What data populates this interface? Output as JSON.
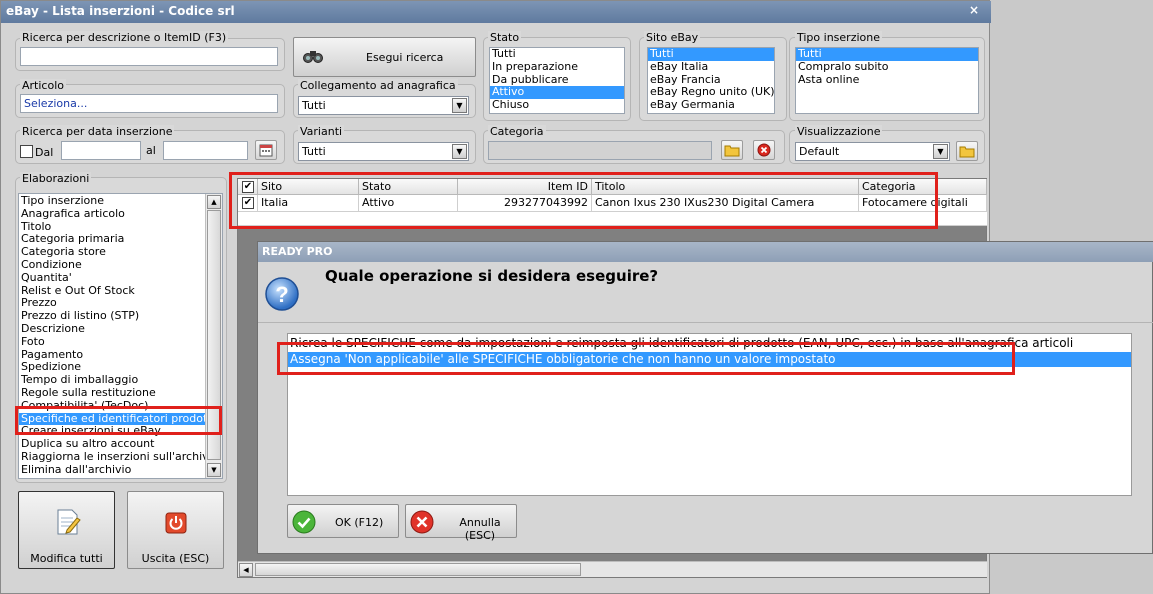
{
  "window": {
    "title": "eBay - Lista inserzioni - Codice srl",
    "close_glyph": "×"
  },
  "search": {
    "legend": "Ricerca per descrizione o ItemID (F3)",
    "value": "",
    "button_label": "Esegui ricerca"
  },
  "articolo": {
    "legend": "Articolo",
    "value": "Seleziona..."
  },
  "collegamento": {
    "legend": "Collegamento ad anagrafica",
    "selected": "Tutti"
  },
  "data_inserzione": {
    "legend": "Ricerca per data inserzione",
    "dal_label": "Dal",
    "al_label": "al",
    "dal_value": "",
    "al_value": ""
  },
  "varianti": {
    "legend": "Varianti",
    "selected": "Tutti"
  },
  "stato": {
    "legend": "Stato",
    "items": [
      "Tutti",
      "In preparazione",
      "Da pubblicare",
      "Attivo",
      "Chiuso"
    ],
    "selected_index": 3
  },
  "sito_ebay": {
    "legend": "Sito eBay",
    "items": [
      "Tutti",
      "eBay Italia",
      "eBay Francia",
      "eBay Regno unito (UK)",
      "eBay Germania"
    ],
    "selected_index": 0
  },
  "tipo_inserzione": {
    "legend": "Tipo inserzione",
    "items": [
      "Tutti",
      "Compralo subito",
      "Asta online"
    ],
    "selected_index": 0
  },
  "categoria": {
    "legend": "Categoria",
    "value": ""
  },
  "visualizzazione": {
    "legend": "Visualizzazione",
    "selected": "Default"
  },
  "elaborazioni": {
    "legend": "Elaborazioni",
    "items": [
      "Tipo inserzione",
      "Anagrafica articolo",
      "Titolo",
      "Categoria primaria",
      "Categoria store",
      "Condizione",
      "Quantita'",
      "Relist e Out Of Stock",
      "Prezzo",
      "Prezzo di listino (STP)",
      "Descrizione",
      "Foto",
      "Pagamento",
      "Spedizione",
      "Tempo di imballaggio",
      "Regole sulla restituzione",
      "Compatibilita' (TecDoc)",
      "Specifiche ed identificatori prodotto",
      "Creare inserzioni su eBay",
      "Duplica su altro account",
      "Riaggiorna le inserzioni sull'archivio",
      "Elimina dall'archivio"
    ],
    "selected_index": 17
  },
  "actions": {
    "modifica_label": "Modifica tutti",
    "uscita_label": "Uscita (ESC)"
  },
  "grid": {
    "columns": [
      "Sito",
      "Stato",
      "Item ID",
      "Titolo",
      "Categoria"
    ],
    "rows": [
      {
        "checked": true,
        "sito": "Italia",
        "stato": "Attivo",
        "item_id": "293277043992",
        "titolo": "Canon Ixus 230 IXus230 Digital Camera",
        "categoria": "Fotocamere digitali"
      }
    ]
  },
  "dialog": {
    "title": "READY PRO",
    "question": "Quale operazione si desidera eseguire?",
    "options": [
      "Ricrea le SPECIFICHE come da impostazioni e reimposta gli identificatori di prodotto (EAN, UPC, ecc.) in base all'anagrafica articoli",
      "Assegna 'Non applicabile' alle SPECIFICHE obbligatorie che non hanno un valore impostato"
    ],
    "selected_index": 1,
    "ok_label": "OK (F12)",
    "cancel_label": "Annulla (ESC)"
  },
  "colors": {
    "highlight": "#3399ff",
    "annotation_red": "#e0201b",
    "title_bar": "#6d87aa"
  }
}
